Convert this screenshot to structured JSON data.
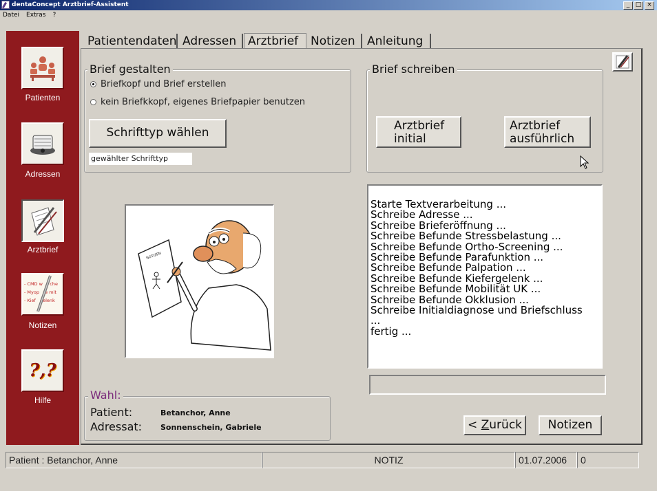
{
  "window": {
    "title": "dentaConcept Arztbrief-Assistent",
    "controls": {
      "minimize": "_",
      "maximize": "□",
      "close": "×"
    }
  },
  "menu": {
    "items": [
      "Datei",
      "Extras",
      "?"
    ]
  },
  "sidebar": {
    "items": [
      {
        "label": "Patienten",
        "icon": "patients-icon"
      },
      {
        "label": "Adressen",
        "icon": "rolodex-icon"
      },
      {
        "label": "Arztbrief",
        "icon": "letter-pen-icon"
      },
      {
        "label": "Notizen",
        "icon": "notes-icon",
        "note_lines": [
          "- CMD w     che",
          "- Myop    e mit",
          "- Kief   gelenk"
        ]
      },
      {
        "label": "Hilfe",
        "icon": "help-icon",
        "glyph": "?,?"
      }
    ]
  },
  "tabs": {
    "items": [
      "Patientendaten",
      "Adressen",
      "Arztbrief",
      "Notizen",
      "Anleitung"
    ],
    "active": "Arztbrief"
  },
  "brief_gestalten": {
    "legend": "Brief gestalten",
    "option1": "Briefkopf und Brief erstellen",
    "option2": "kein Briefkkopf, eigenes Briefpapier benutzen",
    "selected": "option1",
    "font_button": "Schrifttyp wählen",
    "font_label": "gewählter Schrifttyp"
  },
  "brief_schreiben": {
    "legend": "Brief schreiben",
    "btn_initial_l1": "Arztbrief",
    "btn_initial_l2": "initial",
    "btn_full_l1": "Arztbrief",
    "btn_full_l2": "ausführlich"
  },
  "illustration": {
    "note_text": "NOTIZEN"
  },
  "log": {
    "lines": [
      "Starte Textverarbeitung ...",
      "Schreibe Adresse ...",
      "Schreibe Brieferöffnung ...",
      "Schreibe Befunde Stressbelastung ...",
      "Schreibe Befunde Ortho-Screening ...",
      "Schreibe Befunde Parafunktion ...",
      "Schreibe Befunde Palpation ...",
      "Schreibe Befunde Kiefergelenk ...",
      "Schreibe Befunde Mobilität UK ...",
      "Schreibe Befunde Okklusion ...",
      "Schreibe Initialdiagnose und Briefschluss",
      "...",
      "fertig ..."
    ]
  },
  "progress": {
    "value": 0
  },
  "wahl": {
    "legend": "Wahl:",
    "patient_label": "Patient:",
    "patient_value": "Betanchor, Anne",
    "adressat_label": "Adressat:",
    "adressat_value": "Sonnenschein, Gabriele"
  },
  "nav": {
    "back_prefix": "< ",
    "back_accel": "Z",
    "back_rest": "urück",
    "notizen": "Notizen"
  },
  "status": {
    "patient": "Patient : Betanchor, Anne",
    "notiz": "NOTIZ",
    "date": "01.07.2006",
    "count": "0"
  },
  "colors": {
    "sidebar": "#8f1a1e",
    "wahl_legend": "#7a2a7a",
    "window_bg": "#d4d0c8"
  }
}
